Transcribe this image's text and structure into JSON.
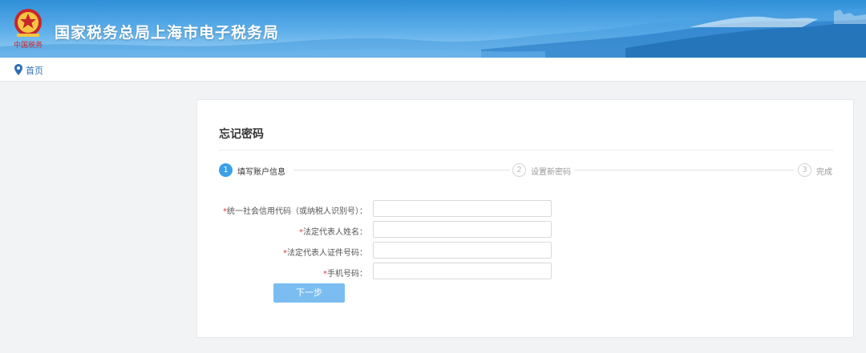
{
  "header": {
    "title": "国家税务总局上海市电子税务局",
    "emblem_text": "中国税务"
  },
  "breadcrumb": {
    "icon": "location-pin-icon",
    "home": "首页"
  },
  "page": {
    "title": "忘记密码"
  },
  "steps": [
    {
      "number": "1",
      "label": "填写账户信息",
      "active": true
    },
    {
      "number": "2",
      "label": "设置新密码",
      "active": false
    },
    {
      "number": "3",
      "label": "完成",
      "active": false
    }
  ],
  "form": {
    "required_mark": "*",
    "fields": [
      {
        "label": "统一社会信用代码（或纳税人识别号）：",
        "value": "",
        "placeholder": ""
      },
      {
        "label": "法定代表人姓名：",
        "value": "",
        "placeholder": ""
      },
      {
        "label": "法定代表人证件号码：",
        "value": "",
        "placeholder": ""
      },
      {
        "label": "手机号码：",
        "value": "",
        "placeholder": ""
      }
    ],
    "submit_label": "下一步"
  },
  "colors": {
    "banner": "#2f8fd8",
    "accent": "#3aa0e8",
    "button": "#7bbdf0",
    "required": "#e0383e"
  }
}
